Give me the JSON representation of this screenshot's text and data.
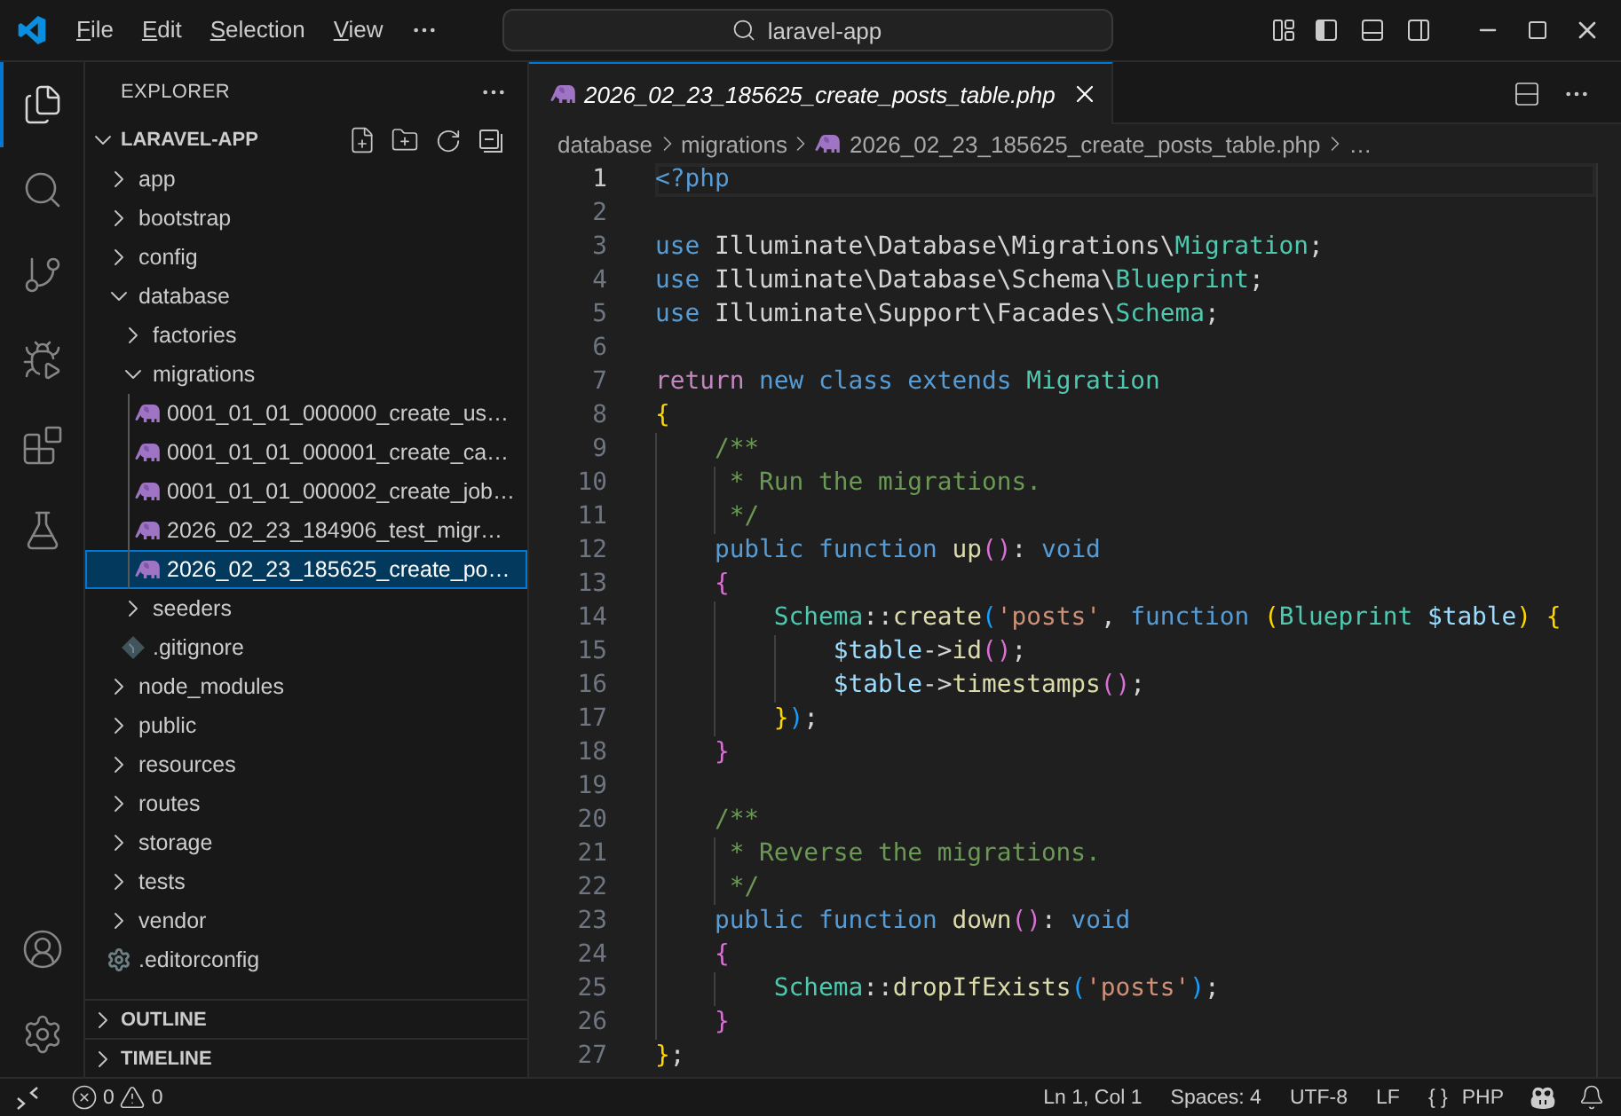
{
  "title_bar": {
    "menus": [
      "File",
      "Edit",
      "Selection",
      "View"
    ],
    "command_center": "laravel-app"
  },
  "activity_bar": {
    "items": [
      {
        "kind": "explorer",
        "selected": true
      },
      {
        "kind": "search",
        "selected": false
      },
      {
        "kind": "source-control",
        "selected": false
      },
      {
        "kind": "run-debug",
        "selected": false
      },
      {
        "kind": "extensions",
        "selected": false
      },
      {
        "kind": "testing",
        "selected": false
      }
    ],
    "bottom": [
      {
        "kind": "account"
      },
      {
        "kind": "settings"
      }
    ]
  },
  "sidebar": {
    "title": "EXPLORER",
    "folder": {
      "name": "LARAVEL-APP",
      "expanded": true
    },
    "tree": [
      {
        "name": "app",
        "kind": "folder",
        "expanded": false,
        "selected": false
      },
      {
        "name": "bootstrap",
        "kind": "folder",
        "expanded": false,
        "selected": false
      },
      {
        "name": "config",
        "kind": "folder",
        "expanded": false,
        "selected": false
      },
      {
        "name": "database",
        "kind": "folder",
        "expanded": true,
        "selected": false,
        "children": [
          {
            "name": "factories",
            "kind": "folder",
            "expanded": false,
            "selected": false
          },
          {
            "name": "migrations",
            "kind": "folder",
            "expanded": true,
            "selected": false,
            "children": [
              {
                "name": "0001_01_01_000000_create_us…",
                "kind": "php",
                "selected": false
              },
              {
                "name": "0001_01_01_000001_create_ca…",
                "kind": "php",
                "selected": false
              },
              {
                "name": "0001_01_01_000002_create_job…",
                "kind": "php",
                "selected": false
              },
              {
                "name": "2026_02_23_184906_test_migr…",
                "kind": "php",
                "selected": false
              },
              {
                "name": "2026_02_23_185625_create_po…",
                "kind": "php",
                "selected": true
              }
            ]
          },
          {
            "name": "seeders",
            "kind": "folder",
            "expanded": false,
            "selected": false
          },
          {
            "name": ".gitignore",
            "kind": "git",
            "selected": false
          }
        ]
      },
      {
        "name": "node_modules",
        "kind": "folder",
        "expanded": false,
        "selected": false
      },
      {
        "name": "public",
        "kind": "folder",
        "expanded": false,
        "selected": false
      },
      {
        "name": "resources",
        "kind": "folder",
        "expanded": false,
        "selected": false
      },
      {
        "name": "routes",
        "kind": "folder",
        "expanded": false,
        "selected": false
      },
      {
        "name": "storage",
        "kind": "folder",
        "expanded": false,
        "selected": false
      },
      {
        "name": "tests",
        "kind": "folder",
        "expanded": false,
        "selected": false
      },
      {
        "name": "vendor",
        "kind": "folder",
        "expanded": false,
        "selected": false
      },
      {
        "name": ".editorconfig",
        "kind": "config",
        "selected": false
      }
    ],
    "sections": [
      {
        "title": "OUTLINE",
        "expanded": false
      },
      {
        "title": "TIMELINE",
        "expanded": false
      }
    ]
  },
  "editor": {
    "tabs": [
      {
        "label": "2026_02_23_185625_create_posts_table.php",
        "selected": true,
        "preview": true
      }
    ],
    "breadcrumb": [
      {
        "kind": "folder",
        "label": "database"
      },
      {
        "kind": "folder",
        "label": "migrations"
      },
      {
        "kind": "file",
        "label": "2026_02_23_185625_create_posts_table.php"
      },
      {
        "kind": "symbol",
        "label": "…"
      }
    ],
    "lines": [
      {
        "number": "1",
        "current": true,
        "tokens": [
          {
            "text": "<?php",
            "kind": "tag"
          }
        ]
      },
      {
        "number": "2",
        "current": false
      },
      {
        "number": "3",
        "current": false,
        "tokens": [
          {
            "text": "use",
            "kind": "keyword"
          },
          {
            "text": " Illuminate\\Database\\Migrations\\",
            "kind": "text"
          },
          {
            "text": "Migration",
            "kind": "class"
          },
          {
            "text": ";",
            "kind": "text"
          }
        ]
      },
      {
        "number": "4",
        "current": false,
        "tokens": [
          {
            "text": "use",
            "kind": "keyword"
          },
          {
            "text": " Illuminate\\Database\\Schema\\",
            "kind": "text"
          },
          {
            "text": "Blueprint",
            "kind": "class"
          },
          {
            "text": ";",
            "kind": "text"
          }
        ]
      },
      {
        "number": "5",
        "current": false,
        "tokens": [
          {
            "text": "use",
            "kind": "keyword"
          },
          {
            "text": " Illuminate\\Support\\Facades\\",
            "kind": "text"
          },
          {
            "text": "Schema",
            "kind": "class"
          },
          {
            "text": ";",
            "kind": "text"
          }
        ]
      },
      {
        "number": "6",
        "current": false
      },
      {
        "number": "7",
        "current": false,
        "tokens": [
          {
            "text": "return",
            "kind": "control"
          },
          {
            "text": " new class extends",
            "kind": "keyword"
          },
          {
            "text": " Migration",
            "kind": "class"
          }
        ]
      },
      {
        "number": "8",
        "current": false,
        "tokens": [
          {
            "text": "{",
            "kind": "bracket1"
          }
        ]
      },
      {
        "number": "9",
        "current": false,
        "tokens": [
          {
            "text": "    /**",
            "kind": "comment"
          }
        ]
      },
      {
        "number": "10",
        "current": false,
        "tokens": [
          {
            "text": "     * Run the migrations.",
            "kind": "comment"
          }
        ]
      },
      {
        "number": "11",
        "current": false,
        "tokens": [
          {
            "text": "     */",
            "kind": "comment"
          }
        ]
      },
      {
        "number": "12",
        "current": false,
        "tokens": [
          {
            "text": "    public function",
            "kind": "keyword"
          },
          {
            "text": " up",
            "kind": "function"
          },
          {
            "text": "()",
            "kind": "bracket2"
          },
          {
            "text": ":",
            "kind": "text"
          },
          {
            "text": " void",
            "kind": "keyword"
          }
        ]
      },
      {
        "number": "13",
        "current": false,
        "tokens": [
          {
            "text": "    {",
            "kind": "bracket2"
          }
        ]
      },
      {
        "number": "14",
        "current": false,
        "tokens": [
          {
            "text": "        Schema",
            "kind": "class"
          },
          {
            "text": "::",
            "kind": "text"
          },
          {
            "text": "create",
            "kind": "function"
          },
          {
            "text": "(",
            "kind": "bracket3"
          },
          {
            "text": "'posts'",
            "kind": "string"
          },
          {
            "text": ",",
            "kind": "text"
          },
          {
            "text": " function",
            "kind": "keyword"
          },
          {
            "text": " (",
            "kind": "bracket1"
          },
          {
            "text": "Blueprint",
            "kind": "class"
          },
          {
            "text": " $table",
            "kind": "variable"
          },
          {
            "text": ")",
            "kind": "bracket1"
          },
          {
            "text": " {",
            "kind": "bracket1"
          }
        ]
      },
      {
        "number": "15",
        "current": false,
        "tokens": [
          {
            "text": "            $table",
            "kind": "variable"
          },
          {
            "text": "->",
            "kind": "text"
          },
          {
            "text": "id",
            "kind": "function"
          },
          {
            "text": "()",
            "kind": "bracket2"
          },
          {
            "text": ";",
            "kind": "text"
          }
        ]
      },
      {
        "number": "16",
        "current": false,
        "tokens": [
          {
            "text": "            $table",
            "kind": "variable"
          },
          {
            "text": "->",
            "kind": "text"
          },
          {
            "text": "timestamps",
            "kind": "function"
          },
          {
            "text": "()",
            "kind": "bracket2"
          },
          {
            "text": ";",
            "kind": "text"
          }
        ]
      },
      {
        "number": "17",
        "current": false,
        "tokens": [
          {
            "text": "        }",
            "kind": "bracket1"
          },
          {
            "text": ")",
            "kind": "bracket3"
          },
          {
            "text": ";",
            "kind": "text"
          }
        ]
      },
      {
        "number": "18",
        "current": false,
        "tokens": [
          {
            "text": "    }",
            "kind": "bracket2"
          }
        ]
      },
      {
        "number": "19",
        "current": false
      },
      {
        "number": "20",
        "current": false,
        "tokens": [
          {
            "text": "    /**",
            "kind": "comment"
          }
        ]
      },
      {
        "number": "21",
        "current": false,
        "tokens": [
          {
            "text": "     * Reverse the migrations.",
            "kind": "comment"
          }
        ]
      },
      {
        "number": "22",
        "current": false,
        "tokens": [
          {
            "text": "     */",
            "kind": "comment"
          }
        ]
      },
      {
        "number": "23",
        "current": false,
        "tokens": [
          {
            "text": "    public function",
            "kind": "keyword"
          },
          {
            "text": " down",
            "kind": "function"
          },
          {
            "text": "()",
            "kind": "bracket2"
          },
          {
            "text": ":",
            "kind": "text"
          },
          {
            "text": " void",
            "kind": "keyword"
          }
        ]
      },
      {
        "number": "24",
        "current": false,
        "tokens": [
          {
            "text": "    {",
            "kind": "bracket2"
          }
        ]
      },
      {
        "number": "25",
        "current": false,
        "tokens": [
          {
            "text": "        Schema",
            "kind": "class"
          },
          {
            "text": "::",
            "kind": "text"
          },
          {
            "text": "dropIfExists",
            "kind": "function"
          },
          {
            "text": "(",
            "kind": "bracket3"
          },
          {
            "text": "'posts'",
            "kind": "string"
          },
          {
            "text": ")",
            "kind": "bracket3"
          },
          {
            "text": ";",
            "kind": "text"
          }
        ]
      },
      {
        "number": "26",
        "current": false,
        "tokens": [
          {
            "text": "    }",
            "kind": "bracket2"
          }
        ]
      },
      {
        "number": "27",
        "current": false,
        "tokens": [
          {
            "text": "}",
            "kind": "bracket1"
          },
          {
            "text": ";",
            "kind": "text"
          }
        ]
      }
    ]
  },
  "status_bar": {
    "errors": "0",
    "warnings": "0",
    "position": "Ln 1, Col 1",
    "indentation": "Spaces: 4",
    "encoding": "UTF-8",
    "line_ending": "LF",
    "language_icon": "{ }",
    "language": "PHP"
  }
}
